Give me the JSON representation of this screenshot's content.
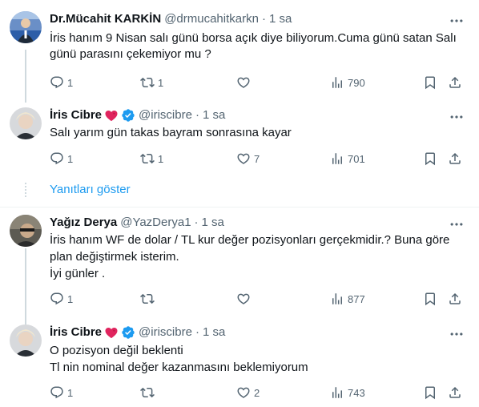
{
  "tweets": [
    {
      "name": "Dr.Mücahit KARKİN",
      "handle": "@drmucahitkarkn",
      "dot": "·",
      "time": "1 sa",
      "text": "İris hanım 9 Nisan salı günü borsa açık diye biliyorum.Cuma günü satan Salı\ngünü parasını çekemiyor mu ?",
      "replies": "1",
      "retweets": "1",
      "likes": "",
      "views": "790"
    },
    {
      "name": "İris Cibre",
      "handle": "@iriscibre",
      "dot": "·",
      "time": "1 sa",
      "text": "Salı yarım gün takas bayram sonrasına kayar",
      "replies": "1",
      "retweets": "1",
      "likes": "7",
      "views": "701"
    },
    {
      "name": "Yağız Derya",
      "handle": "@YazDerya1",
      "dot": "·",
      "time": "1 sa",
      "text": "İris hanım WF de dolar / TL kur değer pozisyonları gerçekmidir.? Buna göre\nplan değiştirmek isterim.\nİyi günler .",
      "replies": "1",
      "retweets": "",
      "likes": "",
      "views": "877"
    },
    {
      "name": "İris Cibre",
      "handle": "@iriscibre",
      "dot": "·",
      "time": "1 sa",
      "text": "O pozisyon değil beklenti\nTl nin nominal değer kazanmasını beklemiyorum",
      "replies": "1",
      "retweets": "",
      "likes": "2",
      "views": "743"
    }
  ],
  "show_replies": "Yanıtları göster",
  "colors": {
    "accent": "#1d9bf0",
    "muted": "#536471",
    "text": "#0f1419",
    "divider": "#eff3f4",
    "verified": "#1d9bf0",
    "heart_badge": "#e0245e"
  },
  "icons": [
    "reply-icon",
    "retweet-icon",
    "like-icon",
    "views-icon",
    "bookmark-icon",
    "share-icon",
    "more-icon",
    "verified-icon",
    "heart-badge-icon"
  ]
}
